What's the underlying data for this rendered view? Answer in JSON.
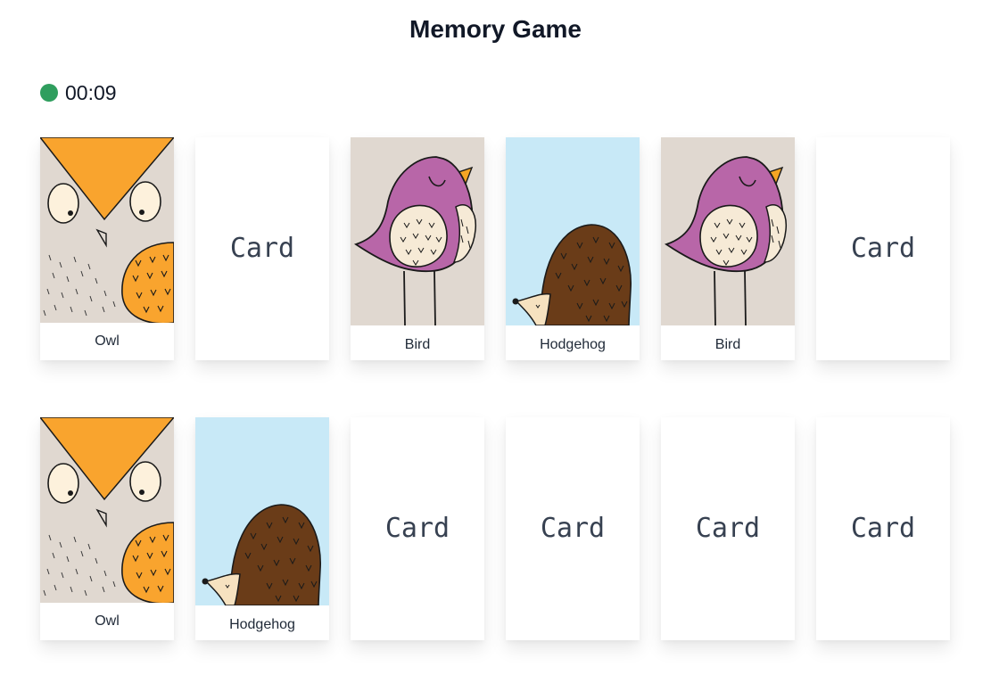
{
  "game": {
    "title": "Memory Game"
  },
  "timer": {
    "value": "00:09",
    "status_color": "#2f9e5e"
  },
  "card_back_label": "Card",
  "cards": [
    {
      "state": "face-up",
      "animal": "owl",
      "label": "Owl"
    },
    {
      "state": "face-down",
      "label": "Card"
    },
    {
      "state": "face-up",
      "animal": "bird",
      "label": "Bird"
    },
    {
      "state": "face-up",
      "animal": "hedgehog",
      "label": "Hodgehog"
    },
    {
      "state": "face-up",
      "animal": "bird",
      "label": "Bird"
    },
    {
      "state": "face-down",
      "label": "Card"
    },
    {
      "state": "face-up",
      "animal": "owl",
      "label": "Owl"
    },
    {
      "state": "face-up",
      "animal": "hedgehog",
      "label": "Hodgehog"
    },
    {
      "state": "face-down",
      "label": "Card"
    },
    {
      "state": "face-down",
      "label": "Card"
    },
    {
      "state": "face-down",
      "label": "Card"
    },
    {
      "state": "face-down",
      "label": "Card"
    }
  ],
  "colors": {
    "owl_bg": "#e0d8d0",
    "owl_orange": "#f9a42e",
    "bird_bg": "#e0d8d0",
    "bird_purple": "#b866a8",
    "bird_wing": "#f6ead6",
    "bird_beak": "#f5a524",
    "hedgehog_bg": "#c8e9f7",
    "hedgehog_body": "#6a3c18",
    "hedgehog_face": "#f6e2c0"
  }
}
